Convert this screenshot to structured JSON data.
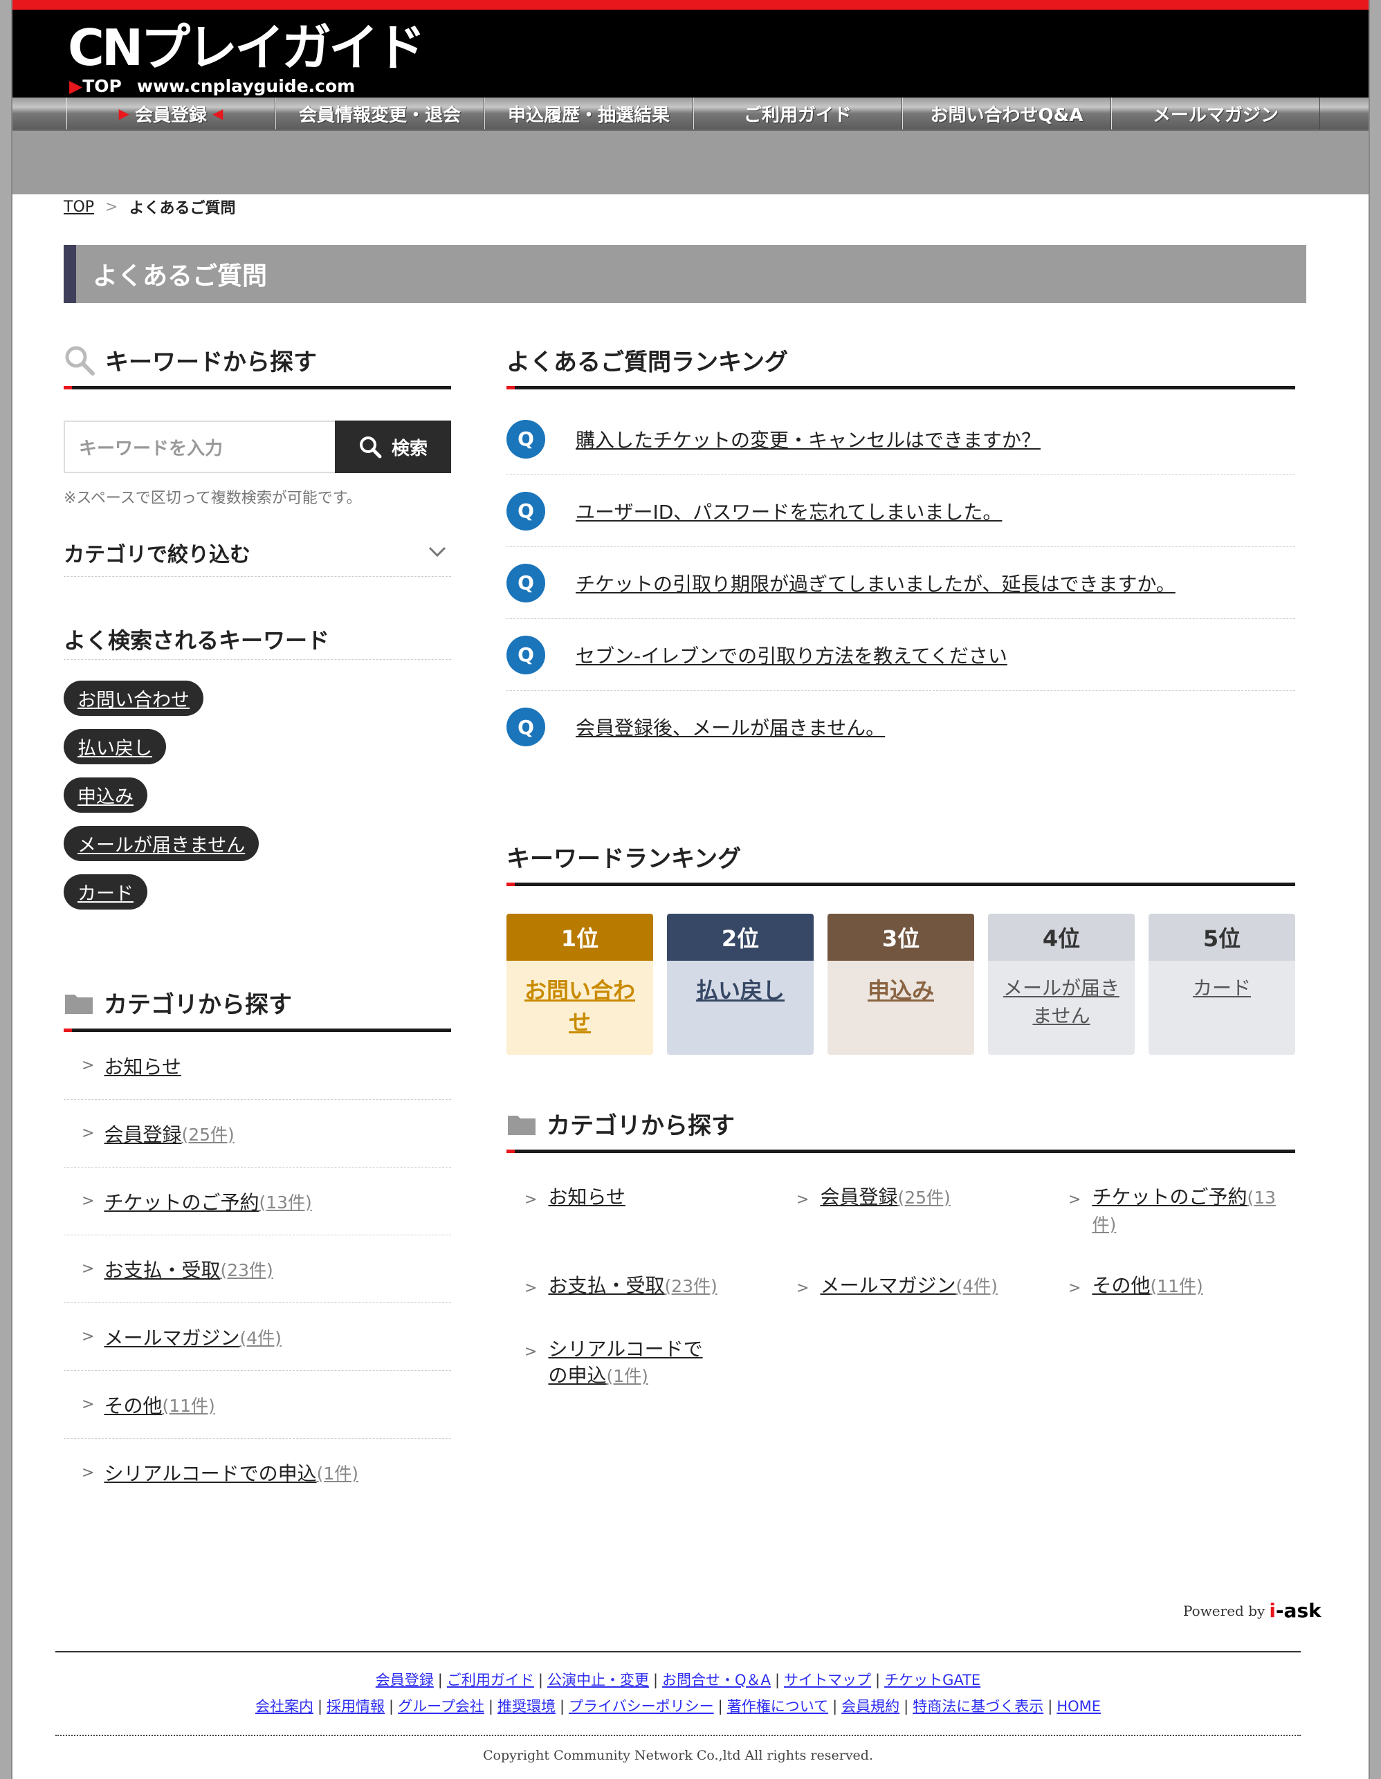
{
  "header": {
    "logo_text": "CNプレイガイド",
    "logo_top": "TOP",
    "logo_url_text": "www.cnplayguide.com"
  },
  "nav": {
    "items": [
      {
        "label": "会員登録"
      },
      {
        "label": "会員情報変更・退会"
      },
      {
        "label": "申込履歴・抽選結果"
      },
      {
        "label": "ご利用ガイド"
      },
      {
        "label": "お問い合わせQ&A"
      },
      {
        "label": "メールマガジン"
      }
    ]
  },
  "breadcrumb": {
    "home": "TOP",
    "current": "よくあるご質問"
  },
  "page_title": "よくあるご質問",
  "search": {
    "heading": "キーワードから探す",
    "placeholder": "キーワードを入力",
    "button": "検索",
    "note": "※スペースで区切って複数検索が可能です。",
    "filter_label": "カテゴリで絞り込む"
  },
  "popular_keywords": {
    "heading": "よく検索されるキーワード",
    "tags": [
      "お問い合わせ",
      "払い戻し",
      "申込み",
      "メールが届きません",
      "カード"
    ]
  },
  "categories": {
    "heading": "カテゴリから探す",
    "items": [
      {
        "name": "お知らせ",
        "count": ""
      },
      {
        "name": "会員登録",
        "count": "(25件)"
      },
      {
        "name": "チケットのご予約",
        "count": "(13件)"
      },
      {
        "name": "お支払・受取",
        "count": "(23件)"
      },
      {
        "name": "メールマガジン",
        "count": "(4件)"
      },
      {
        "name": "その他",
        "count": "(11件)"
      },
      {
        "name": "シリアルコードでの申込",
        "count": "(1件)"
      }
    ]
  },
  "faq_ranking": {
    "heading": "よくあるご質問ランキング",
    "badge": "Q",
    "items": [
      "購入したチケットの変更・キャンセルはできますか？",
      "ユーザーID、パスワードを忘れてしまいました。",
      "チケットの引取り期限が過ぎてしまいましたが、延長はできますか。",
      "セブン-イレブンでの引取り方法を教えてください",
      "会員登録後、メールが届きません。"
    ]
  },
  "keyword_ranking": {
    "heading": "キーワードランキング",
    "items": [
      {
        "rank": "1位",
        "word": "お問い合わせ",
        "head_color": "#b97a00",
        "body_color": "#fdf0d2",
        "text_color": "#c98a00"
      },
      {
        "rank": "2位",
        "word": "払い戻し",
        "head_color": "#374866",
        "body_color": "#d5dbe6",
        "text_color": "#374866"
      },
      {
        "rank": "3位",
        "word": "申込み",
        "head_color": "#735640",
        "body_color": "#ede6e0",
        "text_color": "#8a6442"
      },
      {
        "rank": "4位",
        "word": "メールが届きません",
        "head_color": "#d3d6dc",
        "body_color": "#e6e8ec",
        "text_color": "#555"
      },
      {
        "rank": "5位",
        "word": "カード",
        "head_color": "#d3d6dc",
        "body_color": "#e6e8ec",
        "text_color": "#555"
      }
    ]
  },
  "powered": {
    "prefix": "Powered by",
    "brand_i": "i",
    "brand_rest": "-ask"
  },
  "footer": {
    "row1": [
      "会員登録",
      "ご利用ガイド",
      "公演中止・変更",
      "お問合せ・Q＆A",
      "サイトマップ",
      "チケットGATE"
    ],
    "row2": [
      "会社案内",
      "採用情報",
      "グループ会社",
      "推奨環境",
      "プライバシーポリシー",
      "著作権について",
      "会員規約",
      "特商法に基づく表示",
      "HOME"
    ],
    "copyright": "Copyright Community Network Co.,ltd All rights reserved."
  },
  "colors": {
    "accent_red": "#e8171c",
    "q_blue": "#1b75bb",
    "dark": "#2b2b2b"
  }
}
